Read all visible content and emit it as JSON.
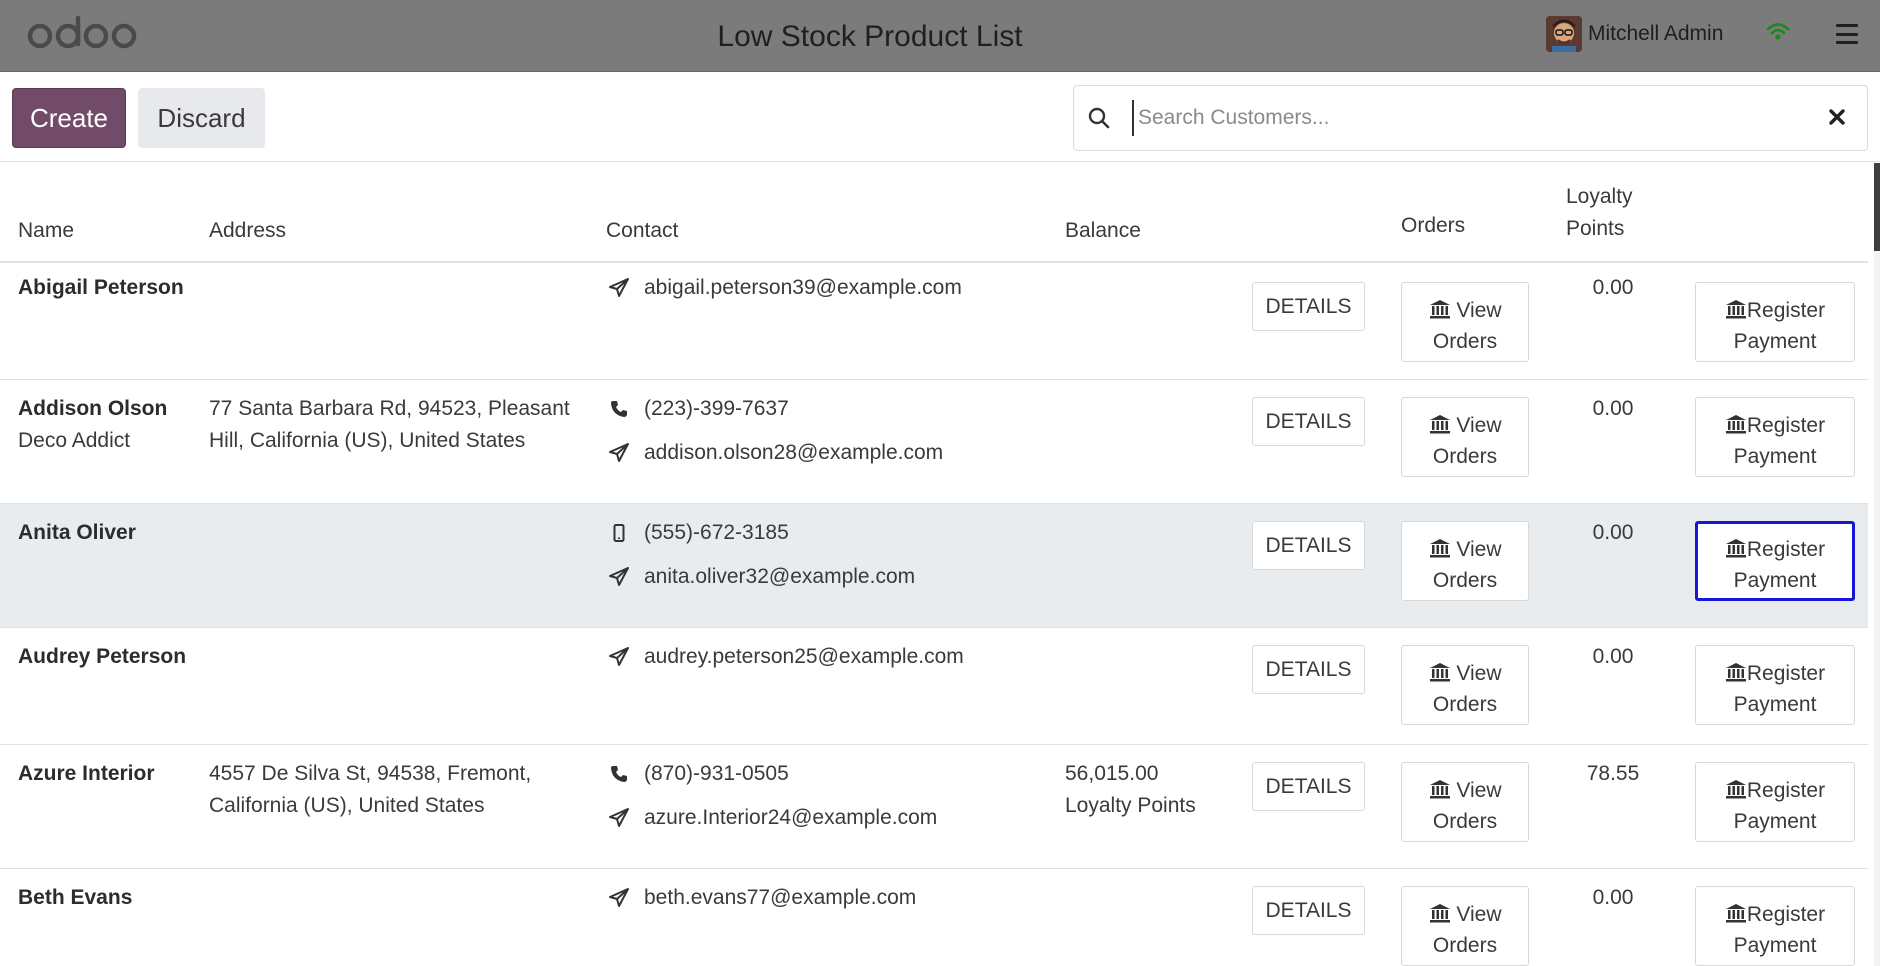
{
  "topbar": {
    "brand": "odoo",
    "title": "Low Stock Product List",
    "user_name": "Mitchell Admin",
    "colors": {
      "bar": "#7b7b7b",
      "wifi": "#1a8a1a"
    }
  },
  "toolbar": {
    "create_label": "Create",
    "discard_label": "Discard",
    "create_color": "#714b67"
  },
  "search": {
    "placeholder": "Search Customers...",
    "value": ""
  },
  "table": {
    "headers": {
      "name": "Name",
      "address": "Address",
      "contact": "Contact",
      "balance": "Balance",
      "orders": "Orders",
      "loyalty": "Loyalty Points"
    },
    "details_label": "DETAILS",
    "view_orders_label": "View Orders",
    "register_payment_label": "Register Payment",
    "rows": [
      {
        "name": "Abigail Peterson",
        "company": "",
        "address": "",
        "phone": "",
        "mobile": "",
        "email": "abigail.peterson39@example.com",
        "balance": "",
        "balance_note": "",
        "loyalty_points": "0.00"
      },
      {
        "name": "Addison Olson",
        "company": "Deco Addict",
        "address": "77 Santa Barbara Rd, 94523, Pleasant Hill, California (US), United States",
        "phone": "(223)-399-7637",
        "mobile": "",
        "email": "addison.olson28@example.com",
        "balance": "",
        "balance_note": "",
        "loyalty_points": "0.00"
      },
      {
        "name": "Anita Oliver",
        "company": "",
        "address": "",
        "phone": "",
        "mobile": "(555)-672-3185",
        "email": "anita.oliver32@example.com",
        "balance": "",
        "balance_note": "",
        "loyalty_points": "0.00",
        "highlighted": true
      },
      {
        "name": "Audrey Peterson",
        "company": "",
        "address": "",
        "phone": "",
        "mobile": "",
        "email": "audrey.peterson25@example.com",
        "balance": "",
        "balance_note": "",
        "loyalty_points": "0.00"
      },
      {
        "name": "Azure Interior",
        "company": "",
        "address": "4557 De Silva St, 94538, Fremont, California (US), United States",
        "phone": "(870)-931-0505",
        "mobile": "",
        "email": "azure.Interior24@example.com",
        "balance": "56,015.00",
        "balance_note": "Loyalty Points",
        "loyalty_points": "78.55"
      },
      {
        "name": "Beth Evans",
        "company": "",
        "address": "",
        "phone": "",
        "mobile": "",
        "email": "beth.evans77@example.com",
        "balance": "",
        "balance_note": "",
        "loyalty_points": "0.00"
      }
    ]
  }
}
